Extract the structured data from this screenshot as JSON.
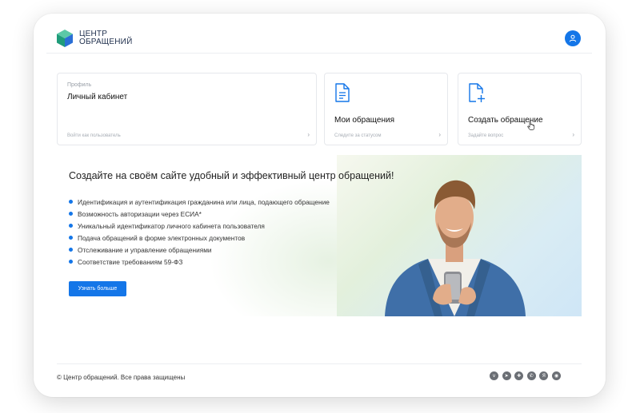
{
  "header": {
    "logo_line1": "ЦЕНТР",
    "logo_line2": "ОБРАЩЕНИЙ",
    "user_icon": "user-icon"
  },
  "cards": [
    {
      "kicker": "Профиль",
      "title": "Личный кабинет",
      "link": "Войти как пользователь",
      "icon": "none"
    },
    {
      "title": "Мои обращения",
      "link": "Следите за статусом",
      "icon": "document-icon"
    },
    {
      "title": "Создать обращение",
      "link": "Задайте вопрос",
      "icon": "add-document-icon"
    }
  ],
  "promo": {
    "title": "Создайте на своём сайте удобный и эффективный центр обращений!",
    "features": [
      "Идентификация и аутентификация гражданина или лица, подающего обращение",
      "Возможность авторизации через ЕСИА*",
      "Уникальный идентификатор личного кабинета пользователя",
      "Подача обращений в форме электронных документов",
      "Отслеживание и управление обращениями",
      "Соответствие требованиям 59-ФЗ"
    ],
    "button": "Узнать больше"
  },
  "footer": {
    "copyright": "© Центр обращений. Все права защищены",
    "socials": [
      "vk-icon",
      "telegram-icon",
      "ok-icon",
      "whatsapp-icon",
      "yandex-icon",
      "dzen-icon"
    ]
  },
  "colors": {
    "accent": "#1476e8",
    "logo_green": "#3dbb8c",
    "logo_blue": "#2a6fd6"
  }
}
